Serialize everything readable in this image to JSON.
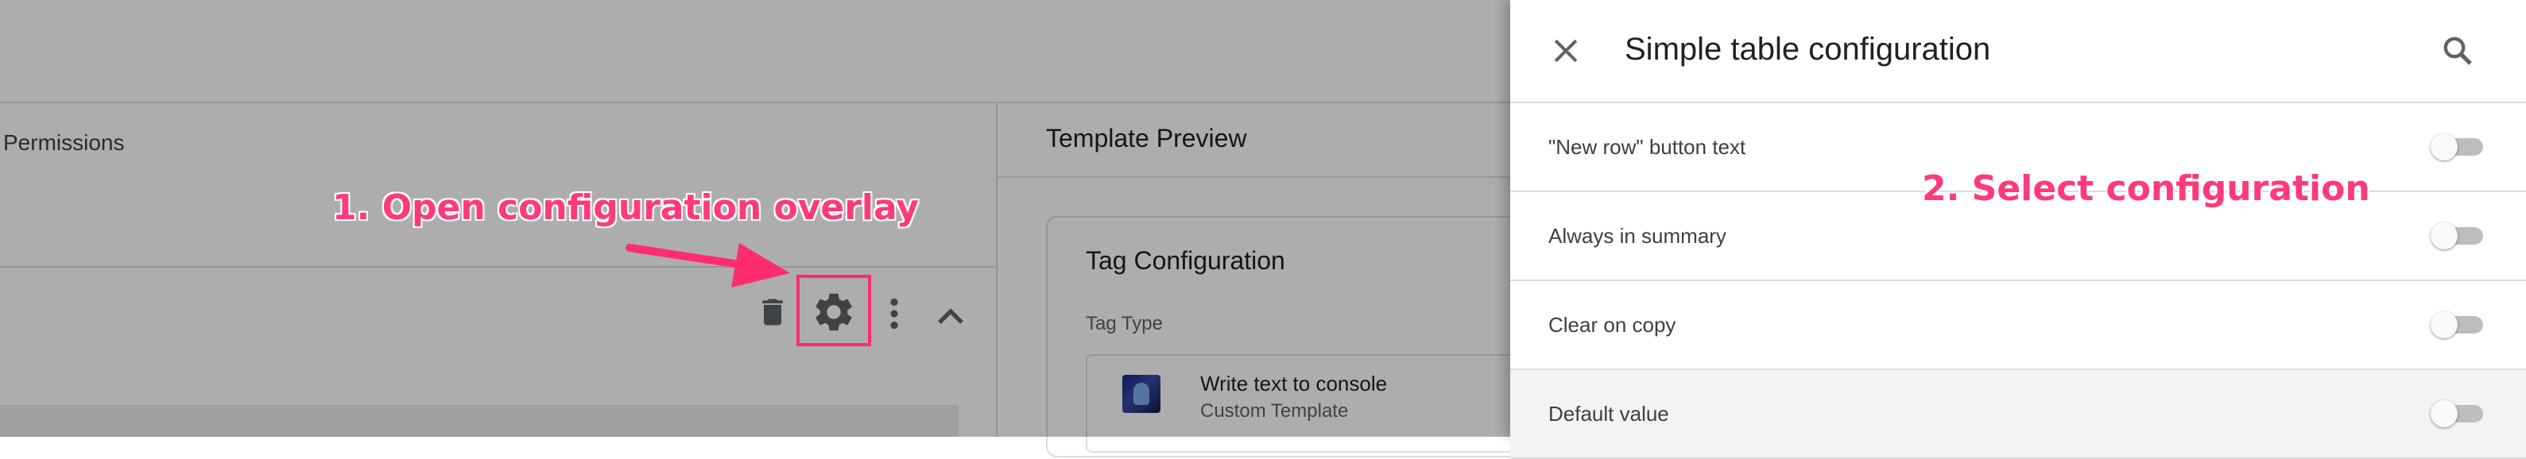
{
  "editor": {
    "permissions_tab": "Permissions",
    "template_preview_title": "Template Preview",
    "tag_configuration_title": "Tag Configuration",
    "tag_type_label": "Tag Type",
    "tag_name": "Write text to console",
    "tag_subtitle": "Custom Template",
    "toolbar_icons": [
      "trash-icon",
      "gear-icon",
      "more-vert-icon",
      "chevron-up-icon"
    ]
  },
  "panel": {
    "title": "Simple table configuration",
    "close_icon": "close-icon",
    "search_icon": "search-icon",
    "rows": [
      {
        "label": "\"New row\" button text",
        "enabled": false
      },
      {
        "label": "Always in summary",
        "enabled": false
      },
      {
        "label": "Clear on copy",
        "enabled": false
      },
      {
        "label": "Default value",
        "enabled": false
      }
    ]
  },
  "annotations": {
    "step1": "1. Open configuration overlay",
    "step2": "2. Select configuration",
    "color": "#ff2d6f"
  },
  "colors": {
    "overlay_dim": "rgba(0,0,0,0.32)",
    "divider": "#dadce0",
    "toggle_track": "#bdbdbd"
  }
}
